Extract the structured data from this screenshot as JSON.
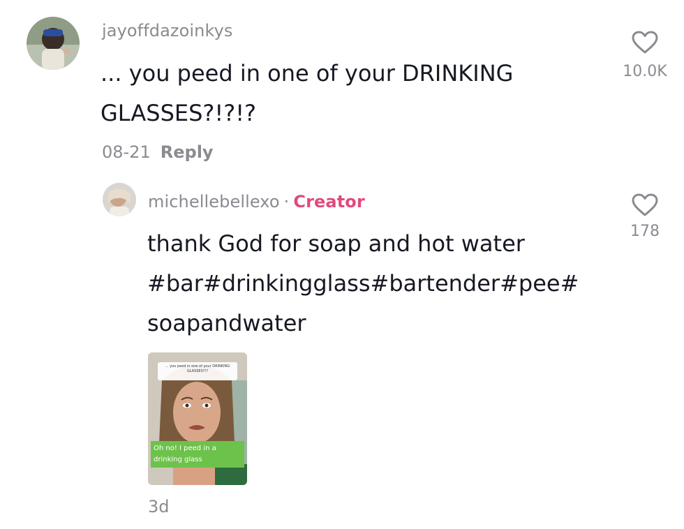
{
  "comment": {
    "username": "jayoffdazoinkys",
    "text_line1": "... you peed in one of your DRINKING",
    "text_line2": "GLASSES?!?!?",
    "date": "08-21",
    "reply_label": "Reply",
    "like_count": "10.0K"
  },
  "reply": {
    "username": "michellebellexo",
    "separator": "·",
    "creator_label": "Creator",
    "text_line1": "thank God for soap and hot water",
    "text_line2": "#bar#drinkingglass#bartender#pee#",
    "text_line3": "soapandwater",
    "like_count": "178",
    "age": "3d",
    "video": {
      "overlay_top": "... you peed in one of your DRINKING GLASSES?!?",
      "caption": "Oh no! I peed in a drinking glass"
    }
  },
  "colors": {
    "text_primary": "#161823",
    "text_secondary": "#8a8b91",
    "creator_accent": "#e04a7d",
    "caption_bg": "#6cc24a"
  },
  "icons": {
    "like": "heart-outline-icon"
  }
}
